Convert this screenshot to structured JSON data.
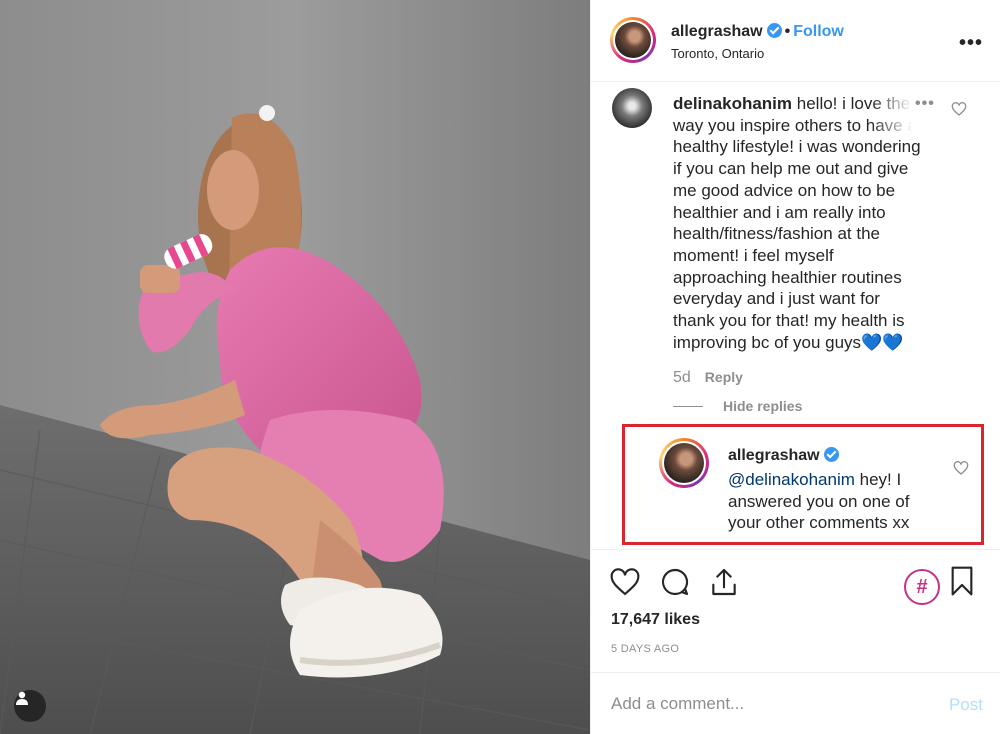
{
  "post": {
    "username": "allegrashaw",
    "follow_label": "Follow",
    "location": "Toronto, Ontario",
    "more_label": "•••"
  },
  "comments": [
    {
      "username": "delinakohanim",
      "text": "hello! i love the way you inspire others to have a healthy lifestyle! i was wondering if you can help me out and give me good advice on how to be healthier and i am really into health/fitness/fashion at the moment! i feel myself approaching healthier routines everyday and i just want for thank you for that! my health is improving bc of you guys💙💙",
      "options_label": "•••",
      "age": "5d",
      "reply_label": "Reply",
      "hide_replies_label": "Hide replies"
    }
  ],
  "reply": {
    "username": "allegrashaw",
    "mention": "@delinakohanim",
    "text": " hey! I answered you on one of your other comments xx"
  },
  "stats": {
    "likes": "17,647 likes",
    "time_ago": "5 DAYS AGO"
  },
  "composer": {
    "placeholder": "Add a comment...",
    "post_label": "Post"
  },
  "icons": {
    "heart": "heart-icon",
    "comment": "comment-icon",
    "share": "share-icon",
    "hashtag": "hashtag-icon",
    "bookmark": "bookmark-icon",
    "user_tag": "user-tag-icon",
    "verified": "verified-badge-icon"
  },
  "colors": {
    "accent": "#3897f0",
    "highlight_box": "#d8262e",
    "hashtag": "#c13584",
    "secondary_text": "#8e8e8e"
  }
}
